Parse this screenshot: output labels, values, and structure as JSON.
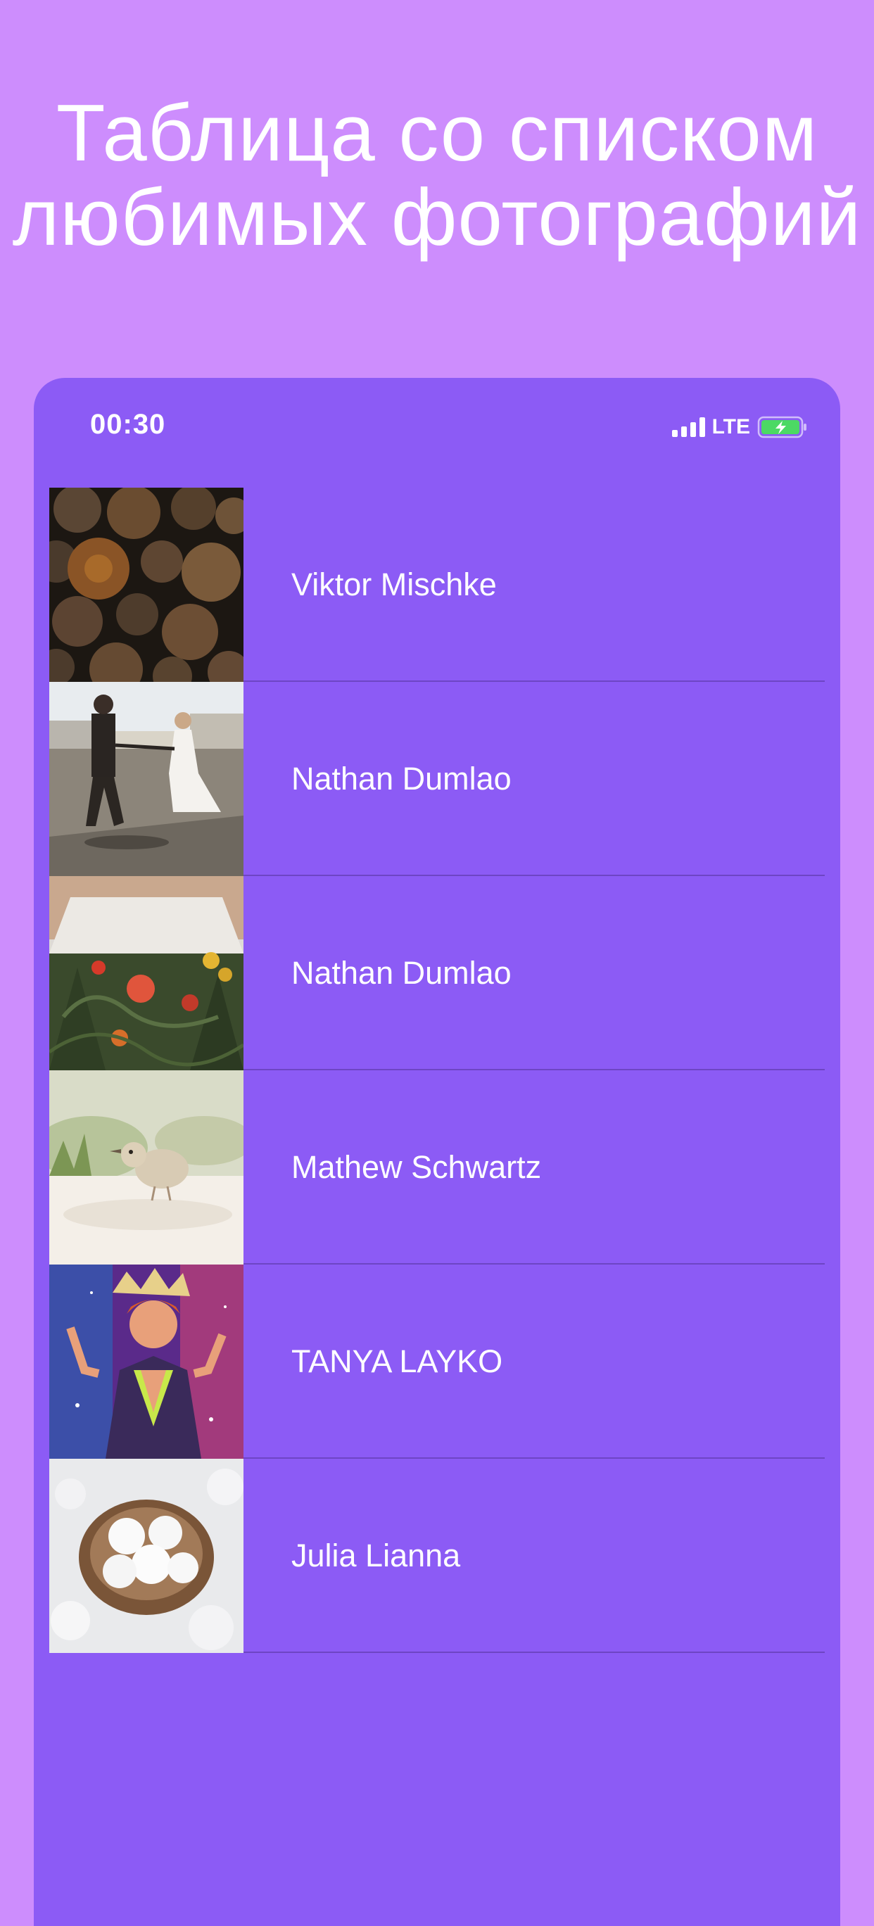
{
  "header": {
    "title_line1": "Таблица со списком",
    "title_line2": "любимых фотографий"
  },
  "status_bar": {
    "time": "00:30",
    "network": "LTE"
  },
  "colors": {
    "page_background": "#cd8dfd",
    "screen_background": "#8c5bf5",
    "text": "#ffffff",
    "battery_fill": "#4cd964"
  },
  "photos": [
    {
      "author": "Viktor Mischke",
      "image": "stacked-logs-photo"
    },
    {
      "author": "Nathan Dumlao",
      "image": "wedding-couple-walking-photo"
    },
    {
      "author": "Nathan Dumlao",
      "image": "bridal-bouquet-photo"
    },
    {
      "author": "Mathew Schwartz",
      "image": "bird-chick-photo"
    },
    {
      "author": "TANYA LAYKO",
      "image": "glitter-portrait-photo"
    },
    {
      "author": "Julia Lianna",
      "image": "coconut-sweets-nest-photo"
    }
  ]
}
